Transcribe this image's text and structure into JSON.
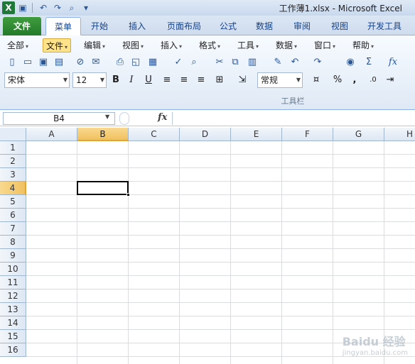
{
  "window": {
    "title": "工作薄1.xlsx  -  Microsoft Excel",
    "app_icon_letter": "X"
  },
  "quick_access": {
    "icons": [
      "save-icon",
      "undo-icon",
      "redo-icon",
      "binoculars-icon",
      "customize-icon"
    ]
  },
  "tabs": [
    {
      "label": "文件",
      "type": "file"
    },
    {
      "label": "菜单",
      "type": "active"
    },
    {
      "label": "开始",
      "type": ""
    },
    {
      "label": "插入",
      "type": ""
    },
    {
      "label": "页面布局",
      "type": ""
    },
    {
      "label": "公式",
      "type": ""
    },
    {
      "label": "数据",
      "type": ""
    },
    {
      "label": "审阅",
      "type": ""
    },
    {
      "label": "视图",
      "type": ""
    },
    {
      "label": "开发工具",
      "type": ""
    }
  ],
  "menus": [
    {
      "label": "全部"
    },
    {
      "label": "文件",
      "active": true
    },
    {
      "label": "编辑"
    },
    {
      "label": "视图"
    },
    {
      "label": "插入"
    },
    {
      "label": "格式"
    },
    {
      "label": "工具"
    },
    {
      "label": "数据"
    },
    {
      "label": "窗口"
    },
    {
      "label": "帮助"
    }
  ],
  "font": {
    "name": "宋体",
    "size": "12",
    "number_format": "常规"
  },
  "format_buttons": {
    "bold": "B",
    "italic": "I",
    "underline": "U",
    "percent": "%",
    "comma": ","
  },
  "ribbon_group_caption": "工具栏",
  "formula_bar": {
    "name_box": "B4",
    "fx_label": "fx",
    "formula": ""
  },
  "columns": [
    "A",
    "B",
    "C",
    "D",
    "E",
    "F",
    "G",
    "H"
  ],
  "rows": [
    "1",
    "2",
    "3",
    "4",
    "5",
    "6",
    "7",
    "8",
    "9",
    "10",
    "11",
    "12",
    "13",
    "14",
    "15",
    "16"
  ],
  "selection": {
    "column": "B",
    "row": "4"
  },
  "watermark": {
    "text": "Baidu 经验",
    "sub": "jingyan.baidu.com"
  },
  "colors": {
    "file_tab": "#2f8a34",
    "active_header": "#f1c15f",
    "grid_line": "#dadcdd"
  }
}
